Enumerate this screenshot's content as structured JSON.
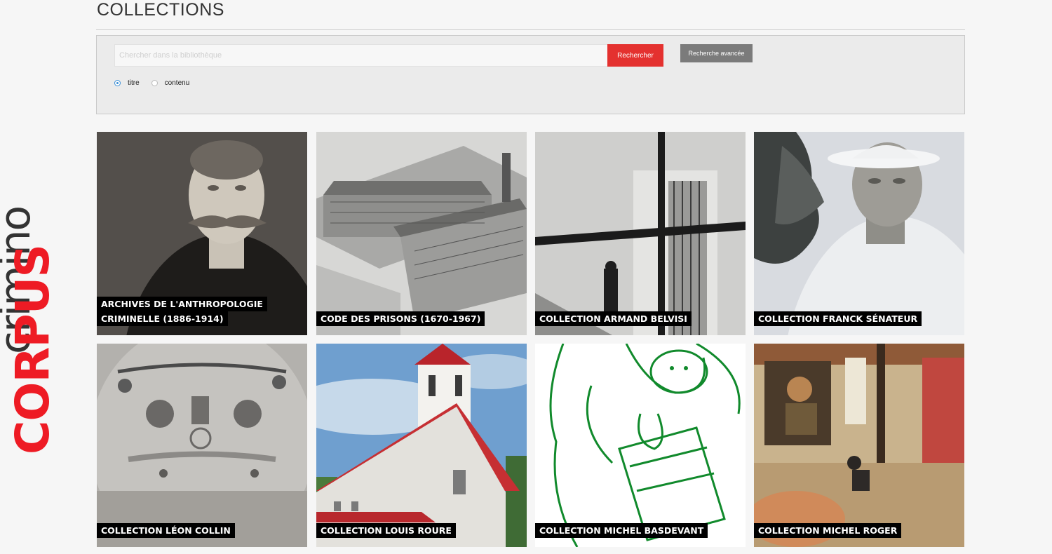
{
  "logo": {
    "word1": "CORPUS",
    "word2": "crimino",
    "color_primary": "#ee1b24",
    "color_secondary": "#333333"
  },
  "page": {
    "title": "COLLECTIONS"
  },
  "search": {
    "placeholder": "Chercher dans la bibliothèque",
    "submit_label": "Rechercher",
    "advanced_label": "Recherche avancée",
    "accent_color": "#e4312f",
    "options": [
      {
        "label": "titre",
        "checked": true
      },
      {
        "label": "contenu",
        "checked": false
      }
    ]
  },
  "collections": [
    {
      "lines": [
        "ARCHIVES DE L'ANTHROPOLOGIE",
        "CRIMINELLE (1886-1914)"
      ],
      "image": "portrait-mustache-man"
    },
    {
      "lines": [
        "CODE DES PRISONS (1670-1967)"
      ],
      "image": "prison-engraving"
    },
    {
      "lines": [
        "COLLECTION ARMAND BELVISI"
      ],
      "image": "prison-window-guard"
    },
    {
      "lines": [
        "COLLECTION FRANCK SÉNATEUR"
      ],
      "image": "old-woman-hat"
    },
    {
      "lines": [
        "COLLECTION LÉON COLLIN"
      ],
      "image": "tattooed-chest"
    },
    {
      "lines": [
        "COLLECTION LOUIS ROURE"
      ],
      "image": "church-building"
    },
    {
      "lines": [
        "COLLECTION MICHEL BASDEVANT"
      ],
      "image": "green-cartoon-drawing"
    },
    {
      "lines": [
        "COLLECTION MICHEL ROGER"
      ],
      "image": "painting-window-scene"
    }
  ]
}
